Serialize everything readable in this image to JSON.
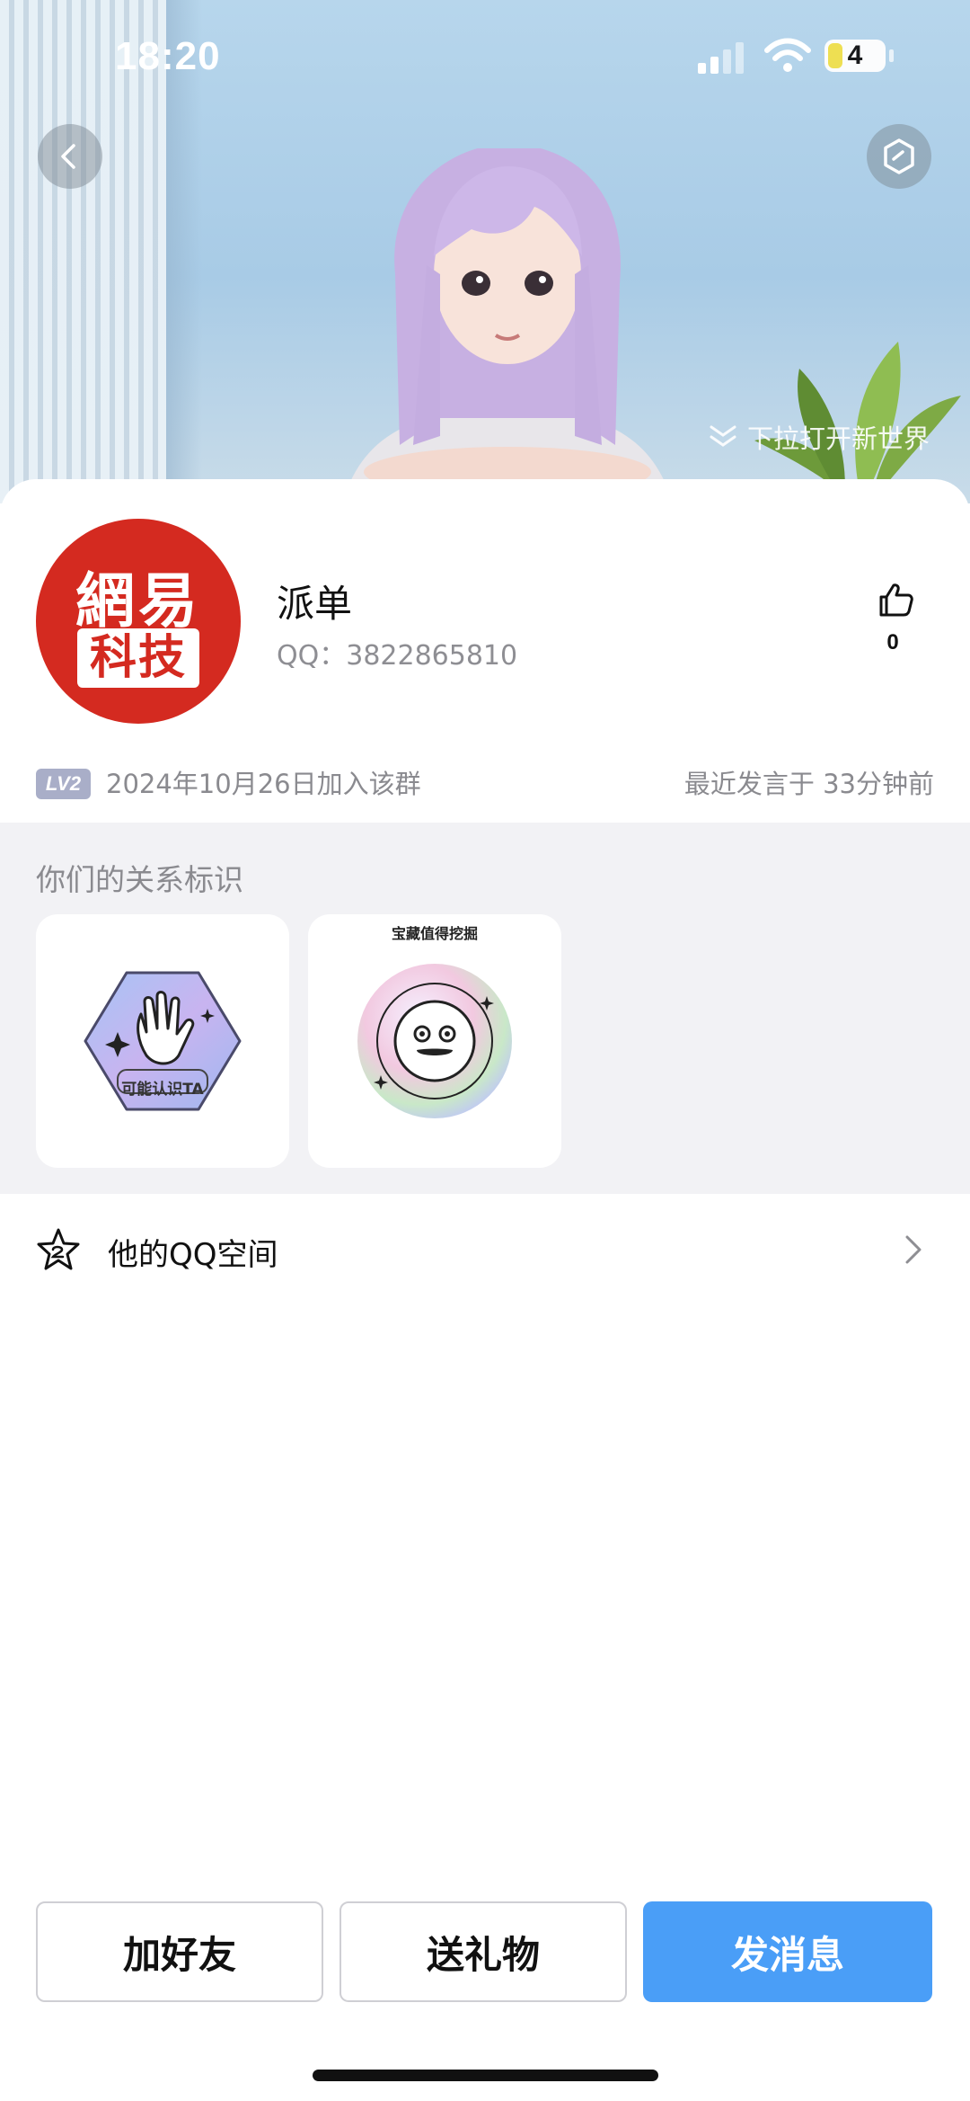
{
  "status_bar": {
    "time": "18:20",
    "battery": "4"
  },
  "header": {
    "pull_hint": "下拉打开新世界"
  },
  "profile": {
    "logo_text_top": "網易",
    "logo_text_bottom": "科技",
    "name": "派单",
    "qq_label": "QQ：3822865810",
    "like_count": "0",
    "level_badge": "LV2",
    "join_date": "2024年10月26日加入该群",
    "last_speak": "最近发言于 33分钟前"
  },
  "relationship": {
    "title": "你们的关系标识",
    "tags": [
      {
        "label": "可能认识TA",
        "icon": "wave-hand-icon"
      },
      {
        "label": "宝藏值得挖掘",
        "icon": "treasure-face-icon"
      }
    ]
  },
  "qzone": {
    "label": "他的QQ空间"
  },
  "actions": {
    "add_friend": "加好友",
    "send_gift": "送礼物",
    "send_message": "发消息"
  },
  "colors": {
    "primary_button": "#4a9ef7",
    "logo_red": "#d42a20",
    "section_background": "#f2f2f5"
  }
}
